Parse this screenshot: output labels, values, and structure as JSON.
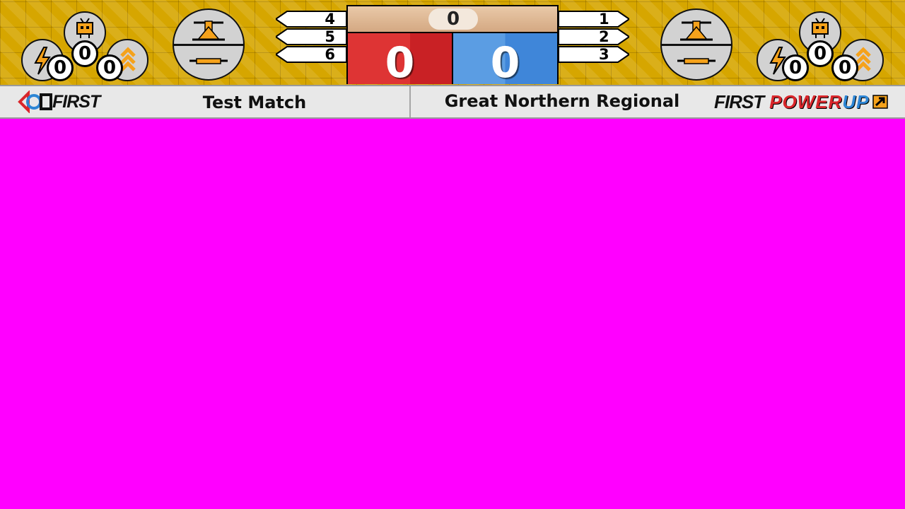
{
  "match": {
    "timer": "0",
    "red_score": "0",
    "blue_score": "0",
    "red_teams": [
      "4",
      "5",
      "6"
    ],
    "blue_teams": [
      "1",
      "2",
      "3"
    ]
  },
  "red_powerups": {
    "boost": "0",
    "force": "0",
    "levitate": "0"
  },
  "blue_powerups": {
    "boost": "0",
    "force": "0",
    "levitate": "0"
  },
  "info": {
    "match_name": "Test Match",
    "event_name": "Great Northern Regional",
    "first_logo_text": "FIRST",
    "game_logo": {
      "first": "FIRST",
      "power": "POWER",
      "up": "UP"
    }
  },
  "colors": {
    "red_alliance": "#de3434",
    "blue_alliance": "#5b9de3",
    "background_key": "#ff00ff",
    "topbar_gold": "#d6a600",
    "powerup_orange": "#f5a21b"
  },
  "icons": [
    "tv-robot-icon",
    "lightning-bolt-icon",
    "chevrons-up-icon",
    "scale-icon",
    "switch-icon",
    "first-logo-icon",
    "arrow-up-right-icon"
  ]
}
